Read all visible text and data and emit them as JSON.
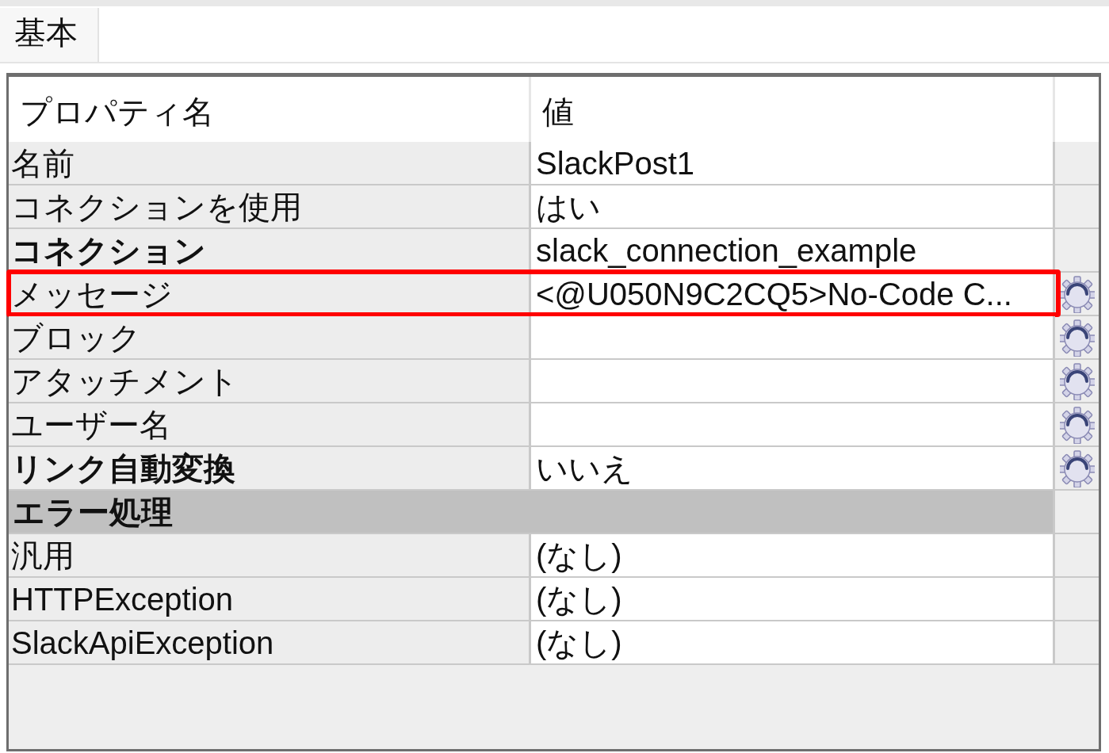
{
  "tabs": [
    {
      "label": "基本",
      "selected": true
    }
  ],
  "grid": {
    "columns": [
      "プロパティ名",
      "値"
    ],
    "rows": [
      {
        "kind": "property",
        "name": "名前",
        "value": "SlackPost1",
        "bold": false,
        "gear": false,
        "highlighted": false
      },
      {
        "kind": "property",
        "name": "コネクションを使用",
        "value": "はい",
        "bold": false,
        "gear": false,
        "highlighted": false
      },
      {
        "kind": "property",
        "name": "コネクション",
        "value": "slack_connection_example",
        "bold": true,
        "gear": false,
        "highlighted": false
      },
      {
        "kind": "property",
        "name": "メッセージ",
        "value": "<@U050N9C2CQ5>No-Code C...",
        "bold": false,
        "gear": true,
        "highlighted": true
      },
      {
        "kind": "property",
        "name": "ブロック",
        "bold": false,
        "gear": true,
        "highlighted": false
      },
      {
        "kind": "property",
        "name": "アタッチメント",
        "bold": false,
        "gear": true,
        "highlighted": false
      },
      {
        "kind": "property",
        "name": "ユーザー名",
        "bold": false,
        "gear": true,
        "highlighted": false
      },
      {
        "kind": "property",
        "name": "リンク自動変換",
        "value": "いいえ",
        "bold": true,
        "gear": true,
        "highlighted": false
      },
      {
        "kind": "category",
        "name": "エラー処理"
      },
      {
        "kind": "property",
        "name": "汎用",
        "value": "(なし)",
        "bold": false,
        "gear": false,
        "highlighted": false
      },
      {
        "kind": "property",
        "name": "HTTPException",
        "value": "(なし)",
        "bold": false,
        "gear": false,
        "highlighted": false
      },
      {
        "kind": "property",
        "name": "SlackApiException",
        "value": "(なし)",
        "bold": false,
        "gear": false,
        "highlighted": false
      }
    ]
  }
}
